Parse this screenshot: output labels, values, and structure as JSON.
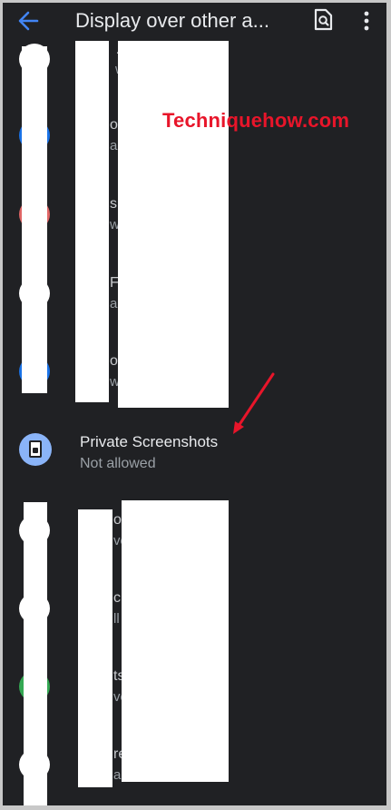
{
  "appbar": {
    "title": "Display over other a...",
    "icons": {
      "back": "back-arrow-icon",
      "search": "search-settings-icon",
      "more": "more-vert-icon"
    },
    "accent": "#4285f4"
  },
  "app_list": [
    {
      "icon_color": "#ffffff",
      "name_fragment": "…",
      "sub_fragment": "w"
    },
    {
      "icon_color": "#1a73e8",
      "name_fragment": "oi",
      "sub_fragment": "al"
    },
    {
      "icon_color": "#e06666",
      "name_fragment": "si",
      "sub_fragment": "w"
    },
    {
      "icon_color": "#ffffff",
      "name_fragment": "FP",
      "sub_fragment": "al"
    },
    {
      "icon_color": "#1a73e8",
      "name_fragment": "on",
      "sub_fragment": "w"
    },
    {
      "icon_color": "#ffffff",
      "name_fragment": "ot",
      "sub_fragment": "ve"
    },
    {
      "icon_color": "#ffffff",
      "name_fragment": "c",
      "sub_fragment": "ll"
    },
    {
      "icon_color": "#34a853",
      "name_fragment": "ts",
      "sub_fragment": "ve"
    },
    {
      "icon_color": "#ffffff",
      "name_fragment": "re",
      "sub_fragment": "allowed"
    }
  ],
  "highlighted_app": {
    "name": "Private Screenshots",
    "status": "Not allowed",
    "icon": "private-screenshots-app-icon",
    "icon_color": "#8ab4f8"
  },
  "watermark": {
    "text": "Techniquehow.com",
    "color": "#e8152a"
  },
  "annotation": {
    "arrow_color": "#e8152a"
  }
}
